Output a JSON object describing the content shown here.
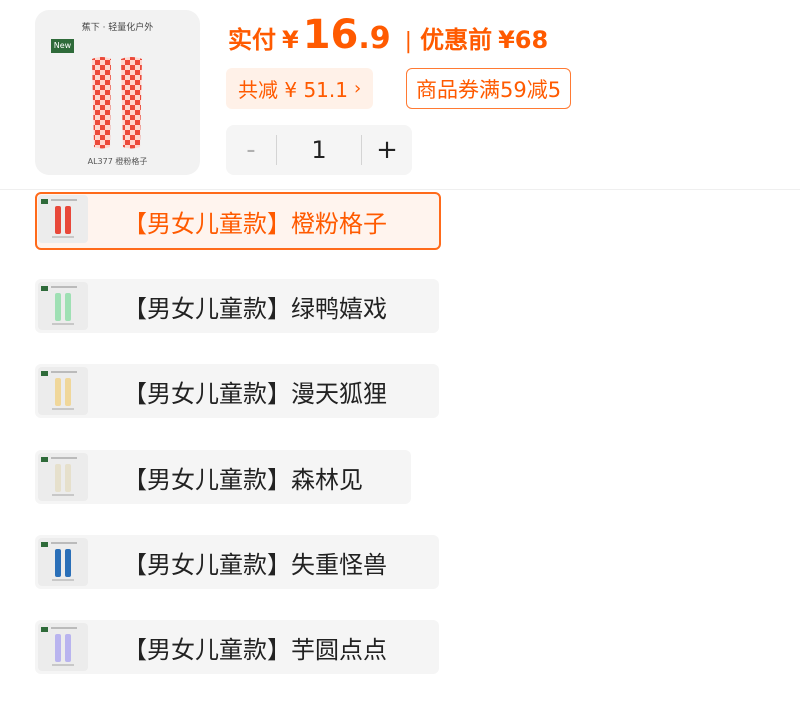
{
  "product": {
    "brand_text": "蕉下 · 轻量化户外",
    "new_badge": "New",
    "code_text": "AL377 橙粉格子"
  },
  "price": {
    "label": "实付",
    "yen": "¥",
    "integer": "16",
    "dot": ".",
    "decimal": "9",
    "separator": "|",
    "original_label": "优惠前",
    "original_value": "¥68"
  },
  "discount": {
    "text": "共减 ¥ 51.1",
    "chevron": "›"
  },
  "coupon": {
    "text": "商品券满59减5"
  },
  "quantity": {
    "minus": "-",
    "value": "1",
    "plus": "+"
  },
  "variants": [
    {
      "label": "【男女儿童款】橙粉格子",
      "color": "#e8483a",
      "selected": true
    },
    {
      "label": "【男女儿童款】绿鸭嬉戏",
      "color": "#9fe0b4",
      "selected": false
    },
    {
      "label": "【男女儿童款】漫天狐狸",
      "color": "#f0d79a",
      "selected": false
    },
    {
      "label": "【男女儿童款】森林见",
      "color": "#e6e0cc",
      "selected": false
    },
    {
      "label": "【男女儿童款】失重怪兽",
      "color": "#2a6fb8",
      "selected": false
    },
    {
      "label": "【男女儿童款】芋圆点点",
      "color": "#b9b4ef",
      "selected": false
    }
  ],
  "colors": {
    "accent": "#ff5a00",
    "selected_border": "#ff6a1a"
  }
}
